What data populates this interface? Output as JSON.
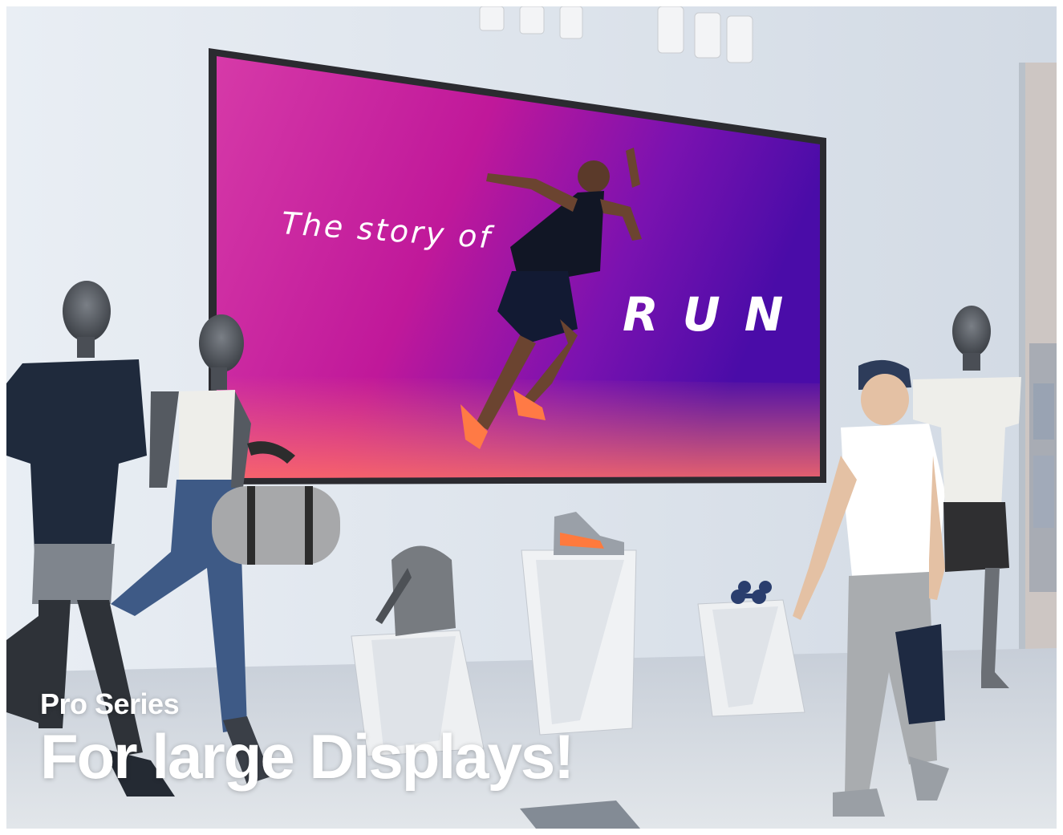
{
  "screen": {
    "line1": "The story of",
    "line2": "RUN"
  },
  "caption": {
    "subtitle": "Pro Series",
    "title": "For large Displays!"
  },
  "colors": {
    "screen_gradient_start": "#d02aa8",
    "screen_gradient_end": "#5a0fb3",
    "floor_glow": "#ff6a6a",
    "caption_text": "#ffffff"
  }
}
